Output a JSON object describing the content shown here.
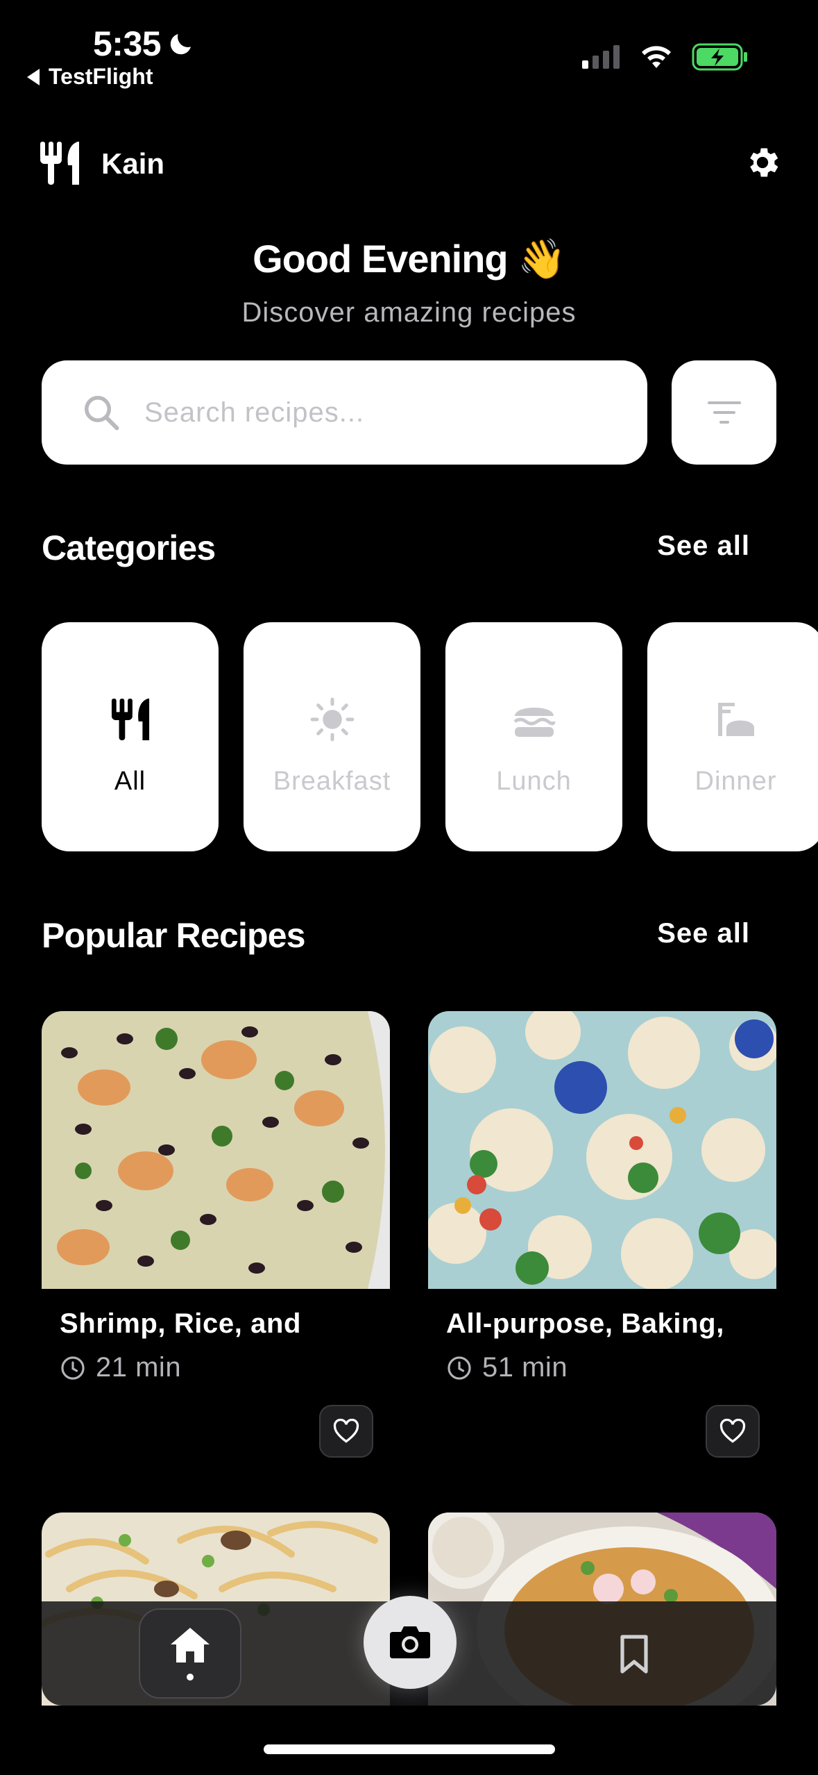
{
  "status_bar": {
    "time": "5:35",
    "back_app": "TestFlight"
  },
  "header": {
    "app_name": "Kain"
  },
  "greeting": {
    "title": "Good Evening 👋",
    "subtitle": "Discover amazing recipes"
  },
  "search": {
    "placeholder": "Search recipes..."
  },
  "categories": {
    "title": "Categories",
    "see_all": "See all",
    "items": [
      {
        "label": "All",
        "icon": "fork-knife-icon",
        "active": true
      },
      {
        "label": "Breakfast",
        "icon": "sun-icon",
        "active": false
      },
      {
        "label": "Lunch",
        "icon": "burger-icon",
        "active": false
      },
      {
        "label": "Dinner",
        "icon": "dinner-icon",
        "active": false
      }
    ]
  },
  "popular": {
    "title": "Popular Recipes",
    "see_all": "See all",
    "recipes": [
      {
        "title": "Shrimp, Rice, and",
        "time": "21 min"
      },
      {
        "title": "All-purpose, Baking,",
        "time": "51 min"
      }
    ]
  },
  "colors": {
    "background": "#000000",
    "card": "#ffffff",
    "muted_text": "#b7b7bc",
    "battery": "#4cd964"
  },
  "tab_bar": {
    "tabs": [
      "home-icon",
      "camera-icon",
      "bookmark-icon"
    ],
    "active": "home-icon"
  }
}
